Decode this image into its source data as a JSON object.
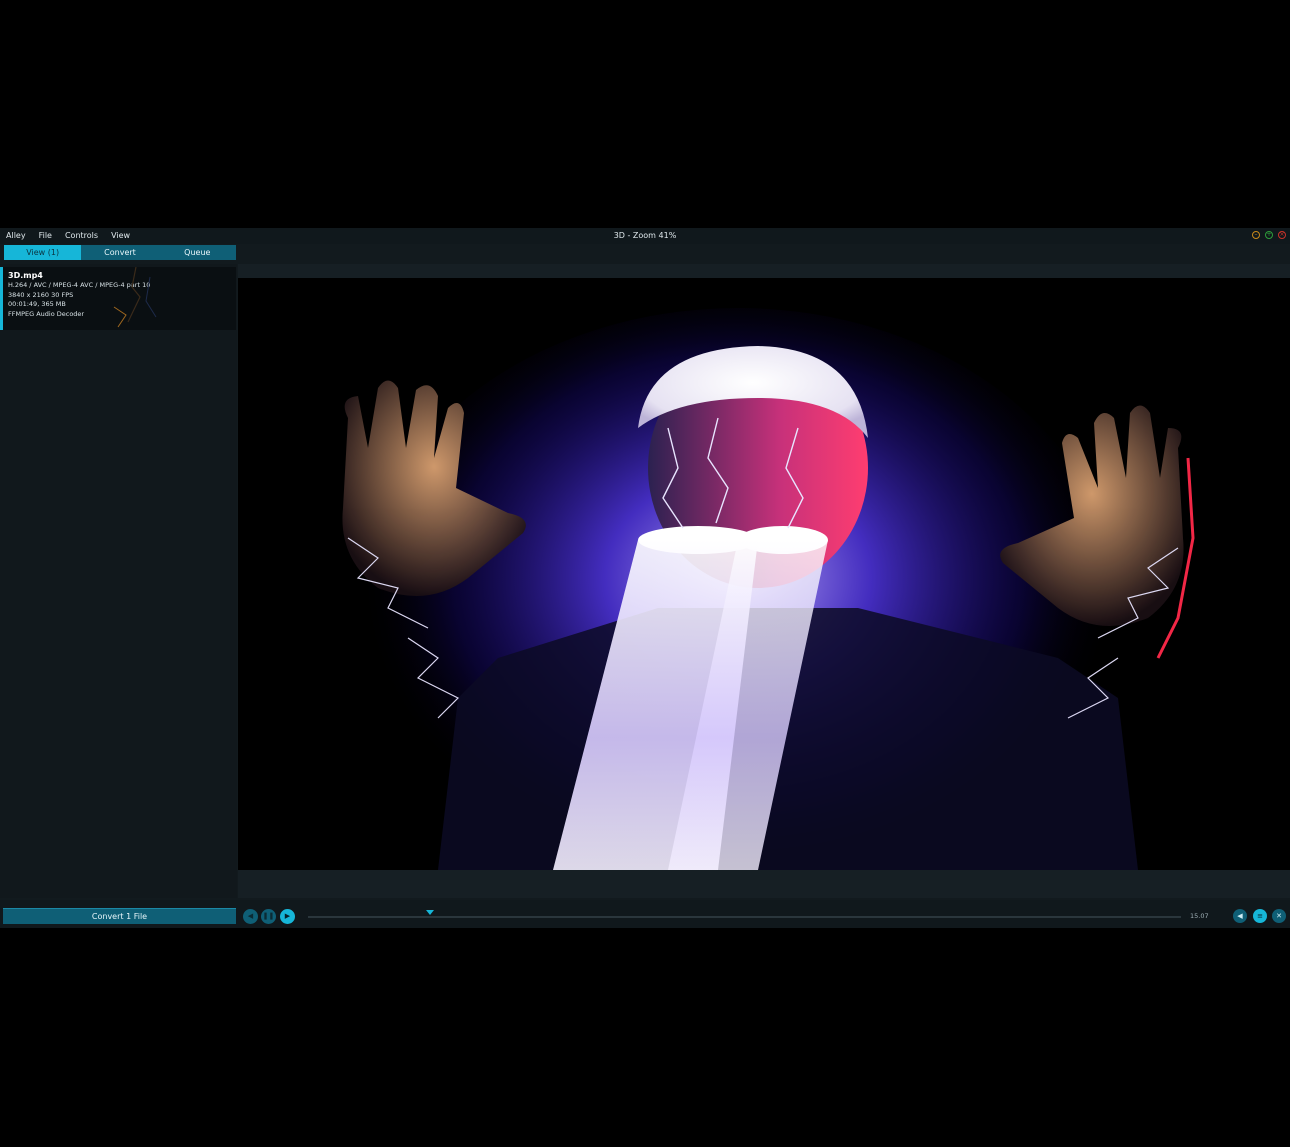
{
  "menu": {
    "items": [
      "Alley",
      "File",
      "Controls",
      "View"
    ]
  },
  "window": {
    "title": "3D - Zoom 41%"
  },
  "tabs": [
    {
      "label": "View (1)"
    },
    {
      "label": "Convert"
    },
    {
      "label": "Queue"
    }
  ],
  "file": {
    "name": "3D.mp4",
    "codec": "H.264 / AVC / MPEG-4 AVC / MPEG-4 part 10",
    "resolution": "3840 x 2160 30 FPS",
    "duration_size": "00:01:49, 365 MB",
    "audio": "FFMPEG Audio Decoder"
  },
  "controls": {
    "convert_label": "Convert 1 File",
    "time": "15.07",
    "progress_fraction": 0.14
  },
  "colors": {
    "accent": "#16b6d8",
    "accent_dark": "#0f5f76",
    "background": "#121a1e"
  },
  "icons": {
    "prev": "skip-back-icon",
    "pause": "pause-icon",
    "play": "play-icon",
    "volume": "volume-icon",
    "playlist": "list-icon",
    "fullscreen": "fullscreen-icon"
  }
}
